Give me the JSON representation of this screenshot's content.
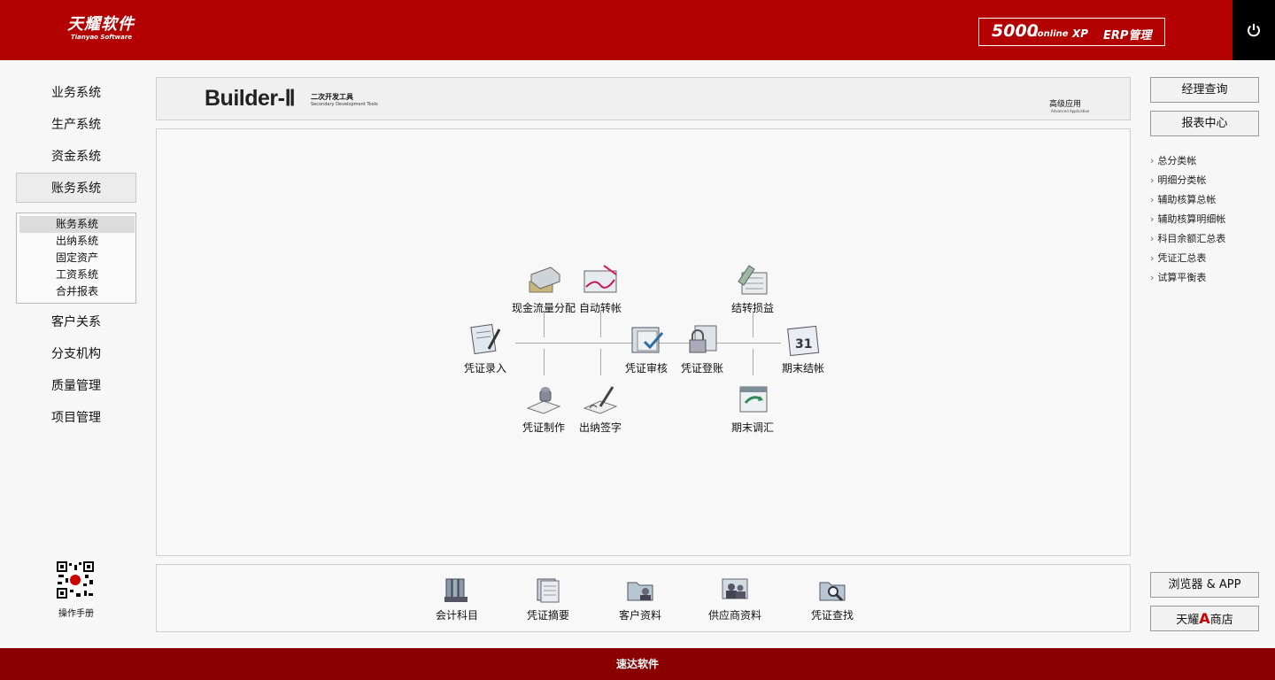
{
  "header": {
    "logo_cn": "天耀软件",
    "logo_en": "Tianyao Software",
    "product_number": "5000",
    "product_suffix": ".online",
    "product_xp": "XP",
    "product_erp": "ERP管理"
  },
  "left_nav": {
    "items": [
      "业务系统",
      "生产系统",
      "资金系统",
      "账务系统",
      "客户关系",
      "分支机构",
      "质量管理",
      "项目管理"
    ],
    "sub_items": [
      "账务系统",
      "出纳系统",
      "固定资产",
      "工资系统",
      "合并报表"
    ],
    "manual_label": "操作手册"
  },
  "banner": {
    "title": "Builder-Ⅱ",
    "subtitle_cn": "二次开发工具",
    "subtitle_en": "Secondary Development Tools",
    "right_cn": "高级应用",
    "right_en": "Advanced Application"
  },
  "flow": {
    "voucher_entry": "凭证录入",
    "cashflow": "现金流量分配",
    "auto_transfer": "自动转帐",
    "voucher_make": "凭证制作",
    "cashier_sign": "出纳签字",
    "voucher_audit": "凭证审核",
    "voucher_post": "凭证登账",
    "carry_forward": "结转损益",
    "period_adjust": "期末调汇",
    "period_close": "期末结帐",
    "calendar_day": "31"
  },
  "toolbar": {
    "items": [
      "会计科目",
      "凭证摘要",
      "客户资料",
      "供应商资料",
      "凭证查找"
    ]
  },
  "right_panel": {
    "buttons": [
      "经理查询",
      "报表中心"
    ],
    "links": [
      "总分类帐",
      "明细分类帐",
      "辅助核算总帐",
      "辅助核算明细帐",
      "科目余额汇总表",
      "凭证汇总表",
      "试算平衡表"
    ],
    "browser_app": "浏览器 & APP",
    "store_pre": "天耀",
    "store_a": "A",
    "store_post": "商店"
  },
  "footer": {
    "text": "速达软件"
  },
  "colors": {
    "header": "#b30000",
    "footer": "#8a0000",
    "accent_a": "#cc0000"
  }
}
